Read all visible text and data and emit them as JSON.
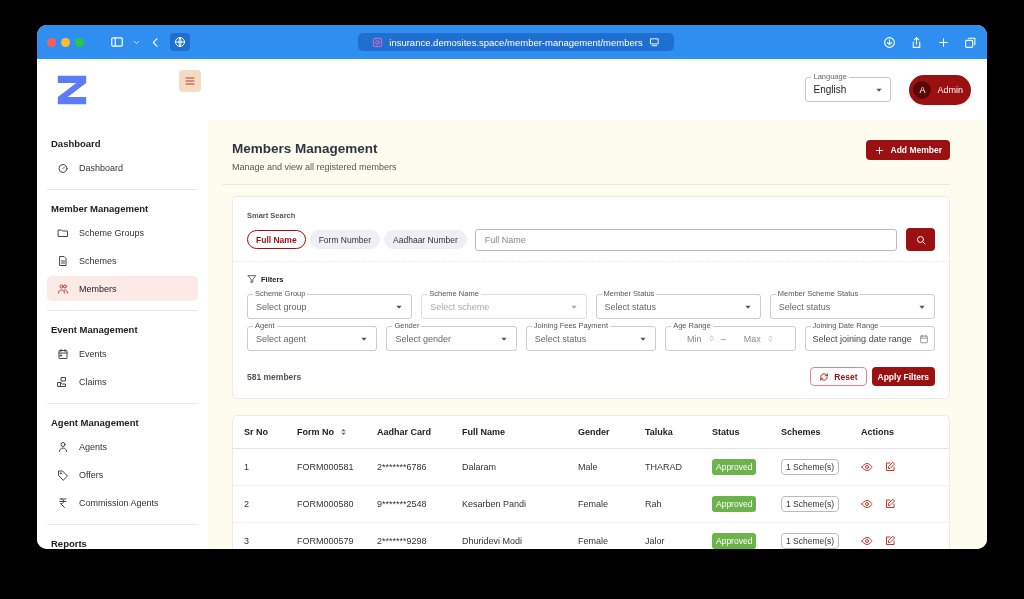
{
  "browser": {
    "url": "insurance.demosites.space/member-management/members"
  },
  "header": {
    "language": {
      "label": "Language",
      "value": "English"
    },
    "user": {
      "initial": "A",
      "name": "Admin"
    }
  },
  "sidebar": {
    "sections": [
      {
        "title": "Dashboard",
        "items": [
          {
            "label": "Dashboard",
            "selected": false
          }
        ]
      },
      {
        "title": "Member Management",
        "items": [
          {
            "label": "Scheme Groups",
            "selected": false
          },
          {
            "label": "Schemes",
            "selected": false
          },
          {
            "label": "Members",
            "selected": true
          }
        ]
      },
      {
        "title": "Event Management",
        "items": [
          {
            "label": "Events",
            "selected": false
          },
          {
            "label": "Claims",
            "selected": false
          }
        ]
      },
      {
        "title": "Agent Management",
        "items": [
          {
            "label": "Agents",
            "selected": false
          },
          {
            "label": "Offers",
            "selected": false
          },
          {
            "label": "Commission Agents",
            "selected": false
          }
        ]
      },
      {
        "title": "Reports"
      }
    ]
  },
  "page": {
    "title": "Members Management",
    "subtitle": "Manage and view all registered members",
    "add_button": "Add Member"
  },
  "search": {
    "label": "Smart Search",
    "placeholder": "Full Name",
    "modes": [
      {
        "label": "Full Name",
        "selected": true
      },
      {
        "label": "Form Number",
        "selected": false
      },
      {
        "label": "Aadhaar Number",
        "selected": false
      }
    ]
  },
  "filters": {
    "title": "Filters",
    "fields": [
      {
        "kind": "select",
        "label": "Scheme Group",
        "placeholder": "Select group",
        "disabled": false
      },
      {
        "kind": "select",
        "label": "Scheme Name",
        "placeholder": "Select scheme",
        "disabled": true
      },
      {
        "kind": "select",
        "label": "Member Status",
        "placeholder": "Select status",
        "disabled": false
      },
      {
        "kind": "select",
        "label": "Member Scheme Status",
        "placeholder": "Select status",
        "disabled": false
      },
      {
        "kind": "select",
        "label": "Agent",
        "placeholder": "Select agent",
        "disabled": false
      },
      {
        "kind": "select",
        "label": "Gender",
        "placeholder": "Select gender",
        "disabled": false
      },
      {
        "kind": "select",
        "label": "Joining Fees Payment",
        "placeholder": "Select status",
        "disabled": false
      },
      {
        "kind": "range",
        "label": "Age Range",
        "min_placeholder": "Min",
        "separator": "–",
        "max_placeholder": "Max"
      },
      {
        "kind": "date",
        "label": "Joining Date Range",
        "placeholder": "Select joining date range"
      }
    ],
    "count": "581 members",
    "reset": "Reset",
    "apply": "Apply Filters"
  },
  "table": {
    "columns": [
      {
        "label": "Sr No",
        "sortable": false
      },
      {
        "label": "Form No",
        "sortable": true
      },
      {
        "label": "Aadhar Card",
        "sortable": false
      },
      {
        "label": "Full Name",
        "sortable": false
      },
      {
        "label": "Gender",
        "sortable": false
      },
      {
        "label": "Taluka",
        "sortable": false
      },
      {
        "label": "Status",
        "sortable": false
      },
      {
        "label": "Schemes",
        "sortable": false
      },
      {
        "label": "Actions",
        "sortable": false
      }
    ],
    "rows": [
      {
        "sr_no": "1",
        "form_no": "FORM000581",
        "aadhar": "2*******6786",
        "name": "Dalaram",
        "gender": "Male",
        "taluka": "THARAD",
        "status": "Approved",
        "schemes": "1 Scheme(s)"
      },
      {
        "sr_no": "2",
        "form_no": "FORM000580",
        "aadhar": "9*******2548",
        "name": "Kesarben Pandi",
        "gender": "Female",
        "taluka": "Rah",
        "status": "Approved",
        "schemes": "1 Scheme(s)"
      },
      {
        "sr_no": "3",
        "form_no": "FORM000579",
        "aadhar": "2*******9298",
        "name": "Dhuridevi Modi",
        "gender": "Female",
        "taluka": "Jalor",
        "status": "Approved",
        "schemes": "1 Scheme(s)"
      }
    ]
  }
}
